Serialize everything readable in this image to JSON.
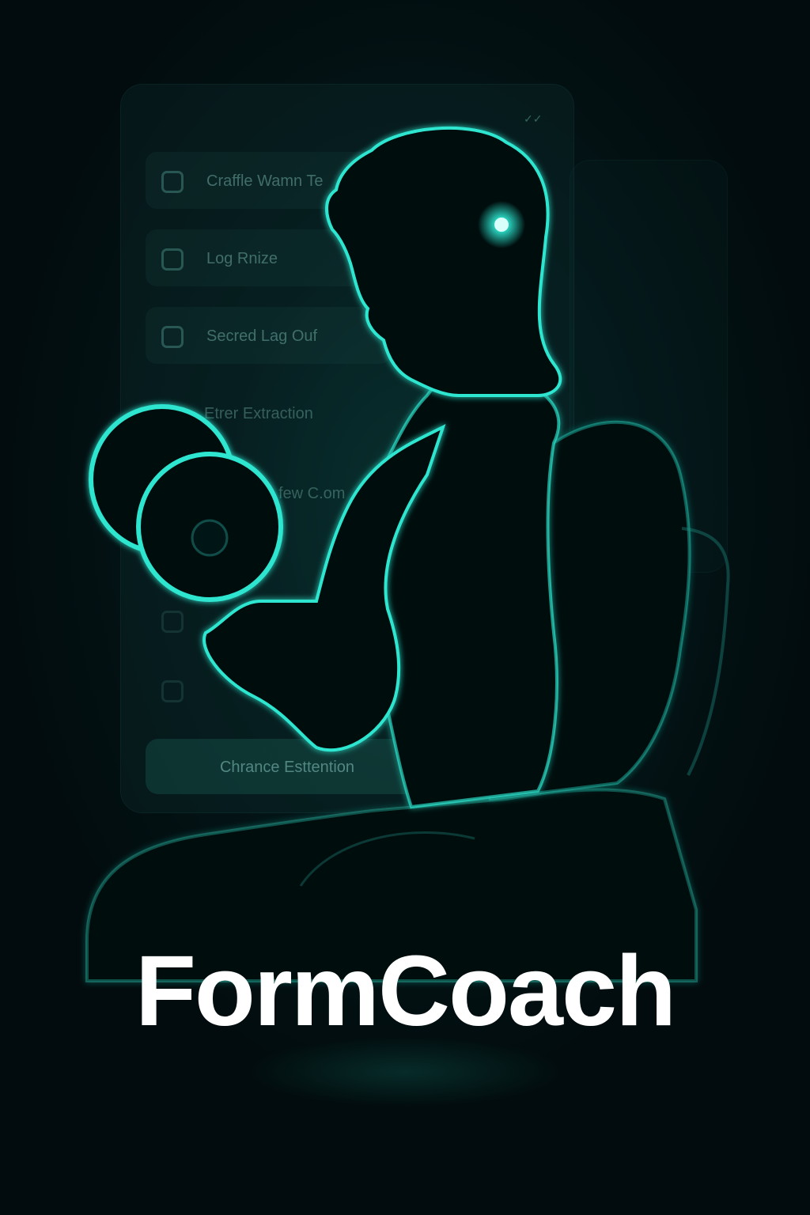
{
  "app": {
    "brand_name": "FormCoach",
    "accent_color": "#2ee6d0",
    "background_color": "#031013"
  },
  "checklist": {
    "items": [
      {
        "label": "Craffle Wamn Te"
      },
      {
        "label": "Log Rnize"
      },
      {
        "label": "Secred Lag Ouf"
      },
      {
        "label": "Etrer Extraction"
      },
      {
        "label": "few C.om"
      }
    ],
    "button_label": "Chrance Esttention",
    "corner_icon": "check-mark-icon"
  },
  "figure": {
    "subject": "athlete-curling-dumbbell-icon",
    "focus_point_icon": "glowing-dot-icon"
  }
}
